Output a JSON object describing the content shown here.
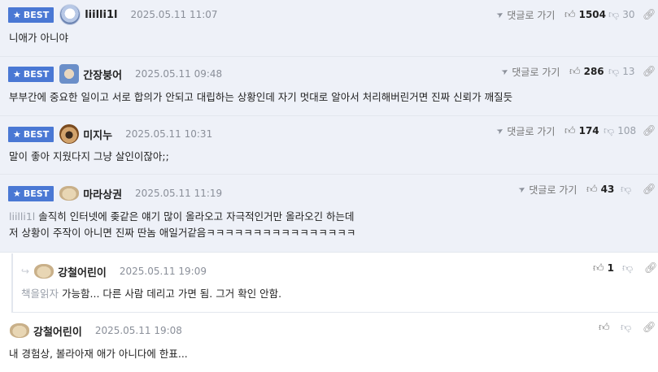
{
  "labels": {
    "best": "BEST",
    "reply_to": "댓글로 가기"
  },
  "comments": [
    {
      "nick": "liilli1l",
      "date": "2025.05.11 11:07",
      "up": "1504",
      "down": "30",
      "text": "니애가 아니야",
      "best": true
    },
    {
      "nick": "간장붕어",
      "date": "2025.05.11 09:48",
      "up": "286",
      "down": "13",
      "text": "부부간에 중요한 일이고 서로 합의가 안되고 대립하는 상황인데 자기 멋대로 알아서 처리해버린거면 진짜 신뢰가 깨질듯",
      "best": true
    },
    {
      "nick": "미지누",
      "date": "2025.05.11 10:31",
      "up": "174",
      "down": "108",
      "text": "말이 좋아 지웠다지 그냥 살인이잖아;;",
      "best": true
    },
    {
      "nick": "마라상권",
      "date": "2025.05.11 11:19",
      "up": "43",
      "down": "",
      "mention": "liilli1l",
      "text_line1": "솔직히 인터넷에 좆같은 얘기 많이 올라오고 자극적인거만 올라오긴 하는데",
      "text_line2": "저 상황이 주작이 아니면 진짜 딴놈 애일거같음ㅋㅋㅋㅋㅋㅋㅋㅋㅋㅋㅋㅋㅋㅋㅋㅋ",
      "best": true
    },
    {
      "nick": "강철어린이",
      "date": "2025.05.11 19:09",
      "up": "1",
      "down": "",
      "mention": "책을읽자",
      "text": "가능함... 다른 사람 데리고 가면 됨. 그거 확인 안함.",
      "best": false
    },
    {
      "nick": "강철어린이",
      "date": "2025.05.11 19:08",
      "up": "",
      "down": "",
      "text": "내 경험상, 볼라아재 애가 아니다에 한표...",
      "best": false
    }
  ],
  "colors": {
    "badge": "#4a78d4",
    "best_bg": "#eef1f8",
    "border": "#e3e7ee"
  }
}
